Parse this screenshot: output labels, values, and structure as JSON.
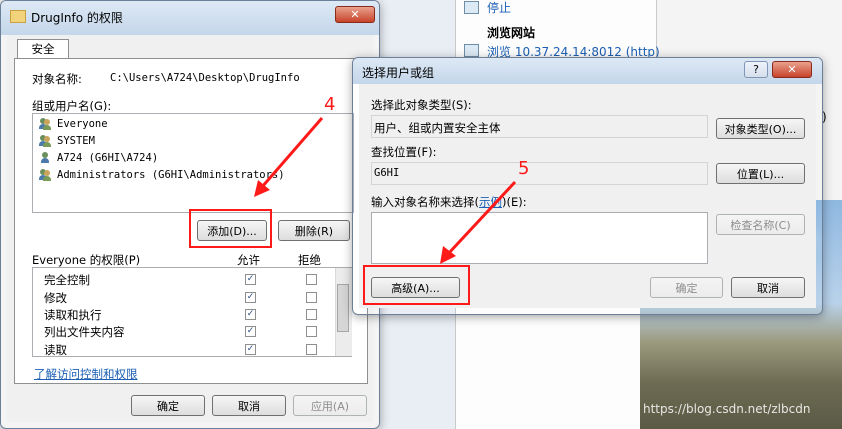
{
  "background": {
    "partial_top": "停止",
    "section_title": "浏览网站",
    "browse_link": "浏览 10.37.24.14:8012 (http)",
    "partial_right": ")"
  },
  "perm_dialog": {
    "title": "DrugInfo 的权限",
    "tab_security": "安全",
    "object_name_label": "对象名称:",
    "object_name_value": "C:\\Users\\A724\\Desktop\\DrugInfo",
    "group_label": "组或用户名(G):",
    "users": [
      "Everyone",
      "SYSTEM",
      "A724 (G6HI\\A724)",
      "Administrators (G6HI\\Administrators)"
    ],
    "add_button": "添加(D)...",
    "remove_button": "删除(R)",
    "permissions_label": "Everyone 的权限(P)",
    "allow_header": "允许",
    "deny_header": "拒绝",
    "permissions": [
      {
        "name": "完全控制",
        "allow": true,
        "deny": false
      },
      {
        "name": "修改",
        "allow": true,
        "deny": false
      },
      {
        "name": "读取和执行",
        "allow": true,
        "deny": false
      },
      {
        "name": "列出文件夹内容",
        "allow": true,
        "deny": false
      },
      {
        "name": "读取",
        "allow": true,
        "deny": false
      }
    ],
    "learn_link": "了解访问控制和权限",
    "ok_button": "确定",
    "cancel_button": "取消",
    "apply_button": "应用(A)"
  },
  "select_dialog": {
    "title": "选择用户或组",
    "help_glyph": "?",
    "close_glyph": "✕",
    "object_type_label": "选择此对象类型(S):",
    "object_type_value": "用户、组或内置安全主体",
    "object_type_button": "对象类型(O)...",
    "location_label": "查找位置(F):",
    "location_value": "G6HI",
    "location_button": "位置(L)...",
    "enter_label_prefix": "输入对象名称来选择(",
    "examples_link": "示例",
    "enter_label_suffix": ")(E):",
    "enter_value": "",
    "check_names_button": "检查名称(C)",
    "advanced_button": "高级(A)...",
    "ok_button": "确定",
    "cancel_button": "取消"
  },
  "annotations": {
    "step4": "4",
    "step5": "5",
    "color": "#ff1a1a"
  },
  "watermark": "https://blog.csdn.net/zlbcdn"
}
